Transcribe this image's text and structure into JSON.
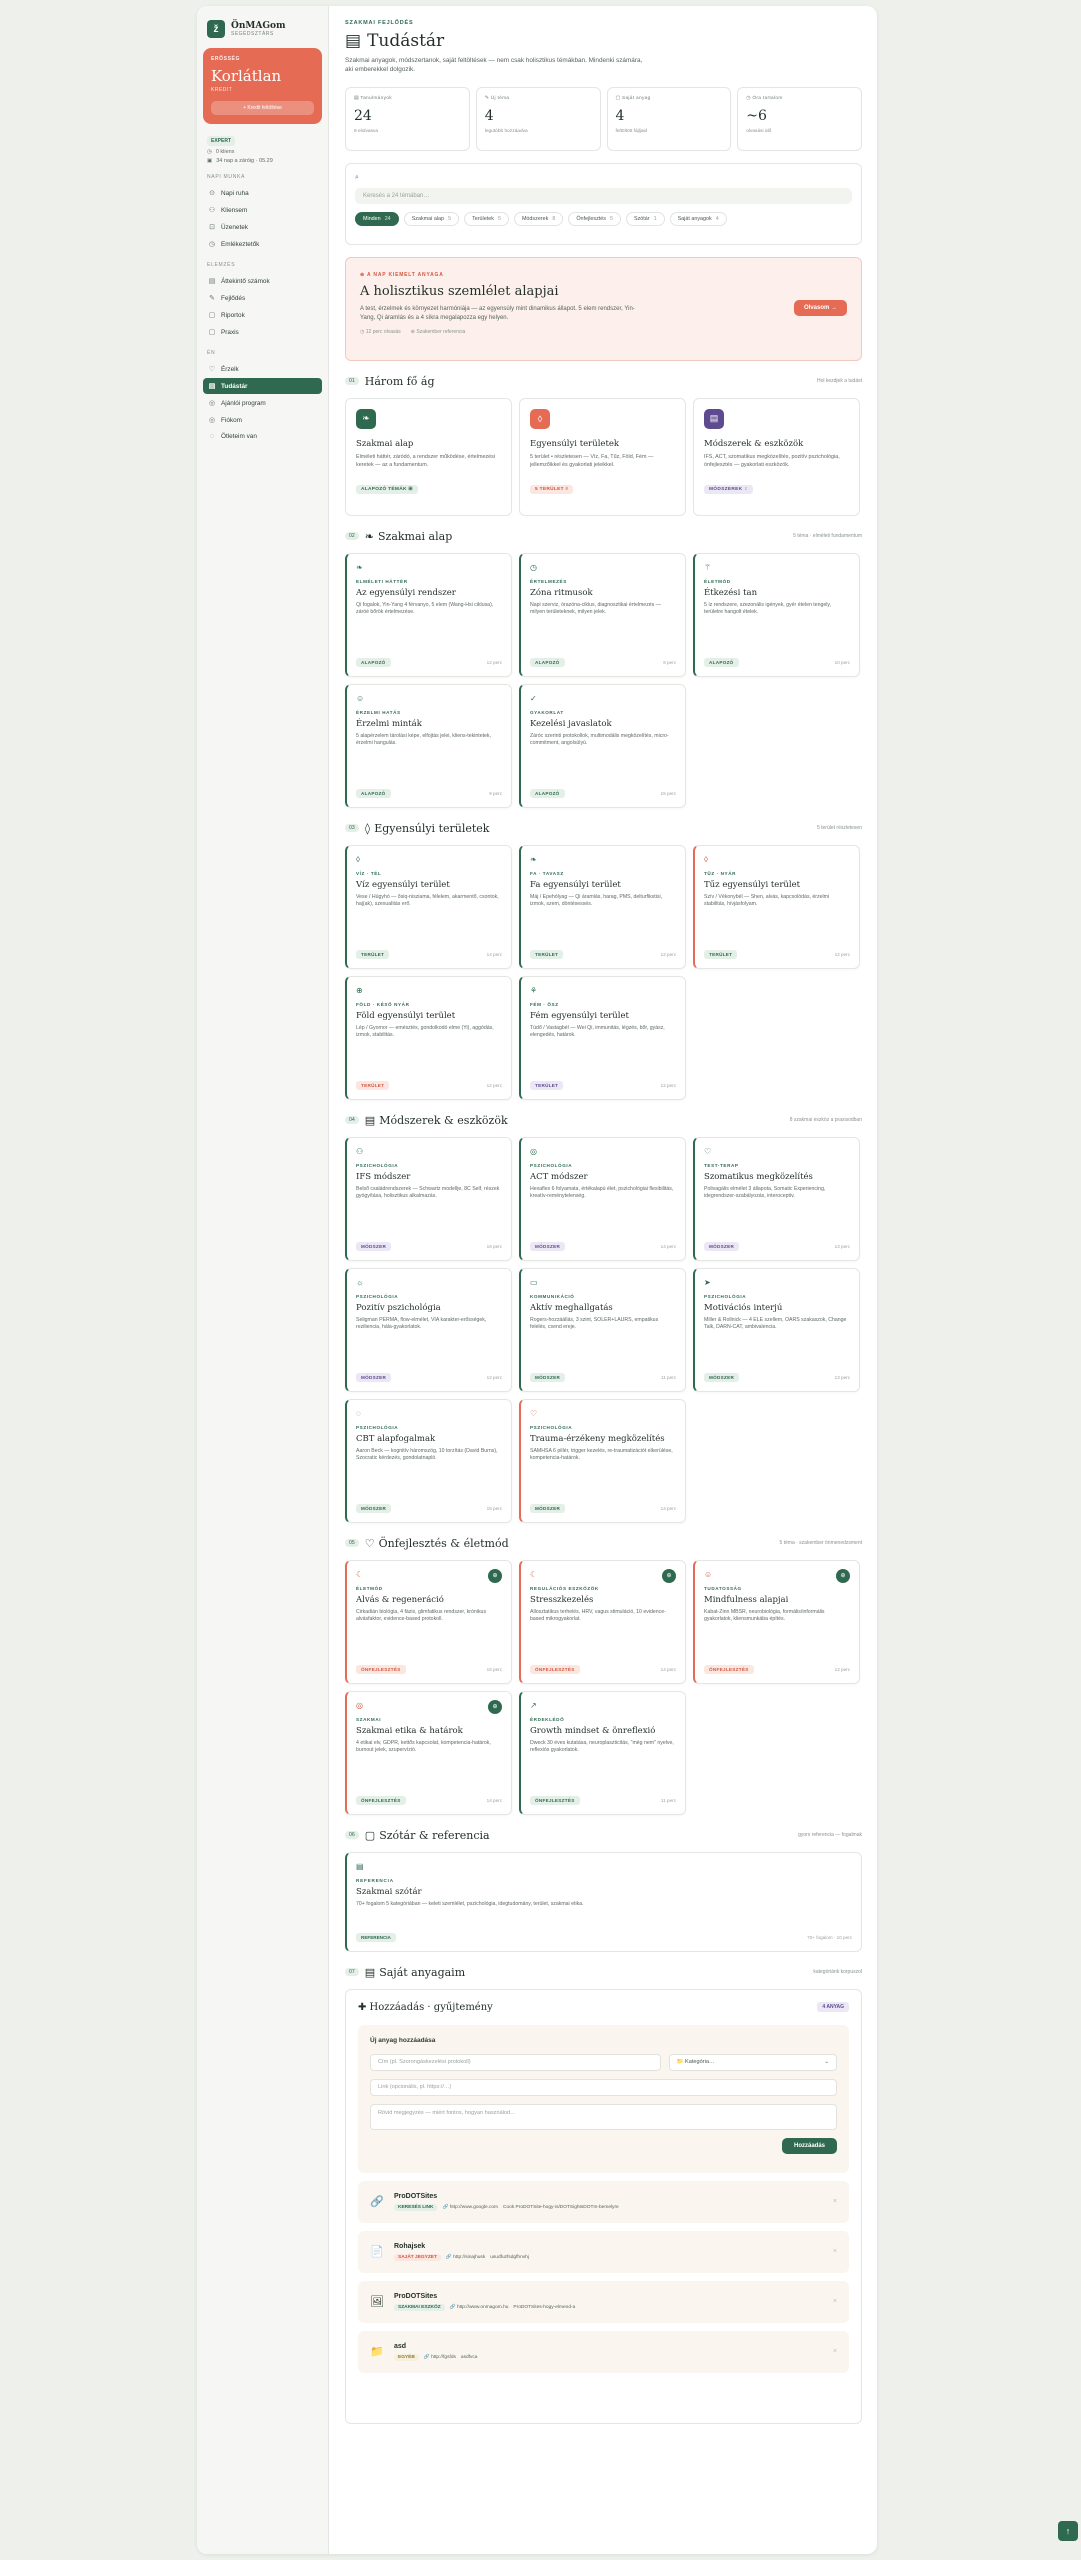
{
  "brand": {
    "logo": "ž",
    "title": "ÖnMAGom",
    "subtitle": "SEGÉDSZTÁRS"
  },
  "user": {
    "label": "ERŐSSÉG",
    "name": "Korlátlan",
    "sub": "KREDIT",
    "button": "+ Kredit feltöltése"
  },
  "sidebar": {
    "role_badge": "EXPERT",
    "meta": [
      {
        "icon": "◷",
        "text": "0 klienx"
      },
      {
        "icon": "▣",
        "text": "34 nap a záróig · 05.29"
      }
    ],
    "sections": [
      {
        "title": "NAPI MUNKA",
        "items": [
          {
            "icon": "⊙",
            "label": "Napi ruha"
          },
          {
            "icon": "⚇",
            "label": "Kliensem"
          },
          {
            "icon": "⊡",
            "label": "Üzenetek"
          },
          {
            "icon": "◷",
            "label": "Emlékeztetők"
          }
        ]
      },
      {
        "title": "ELEMZÉS",
        "items": [
          {
            "icon": "▤",
            "label": "Áttekintő számok"
          },
          {
            "icon": "✎",
            "label": "Fejlődés"
          },
          {
            "icon": "▢",
            "label": "Riportok"
          },
          {
            "icon": "▢",
            "label": "Praxis"
          }
        ]
      },
      {
        "title": "ÉN",
        "items": [
          {
            "icon": "♡",
            "label": "Érzelk"
          },
          {
            "icon": "▤",
            "label": "Tudástár",
            "active": true
          },
          {
            "icon": "◎",
            "label": "Ajánlói program"
          },
          {
            "icon": "◎",
            "label": "Fiókom"
          },
          {
            "icon": "◌",
            "label": "Ötleteim van"
          }
        ]
      }
    ]
  },
  "page": {
    "kicker": "SZAKMAI FEJLŐDÉS",
    "title": "Tudástár",
    "desc": "Szakmai anyagok, módszertanok, saját feltöltések — nem csak holisztikus témákban. Mindenki számára, aki emberekkel dolgozik."
  },
  "stats": [
    {
      "label": "▤ Tanulmányok",
      "value": "24",
      "sub": "9 elolvasva"
    },
    {
      "label": "✎ Új téma",
      "value": "4",
      "sub": "legutóbb hozzáadva"
    },
    {
      "label": "▢ Saját anyag",
      "value": "4",
      "sub": "feltöltött fájljaid"
    },
    {
      "label": "◷ Óra tartalom",
      "value": "~6",
      "sub": "olvasási idő"
    }
  ],
  "search": {
    "placeholder": "Keresés a 24 témában…",
    "chips": [
      {
        "label": "Minden",
        "count": "24",
        "on": true
      },
      {
        "label": "Szakmai alap",
        "count": "5"
      },
      {
        "label": "Területek",
        "count": "5"
      },
      {
        "label": "Módszerek",
        "count": "8"
      },
      {
        "label": "Önfejlesztés",
        "count": "5"
      },
      {
        "label": "Szótár",
        "count": "1"
      },
      {
        "label": "Saját anyagok",
        "count": "4"
      }
    ]
  },
  "hero": {
    "kicker": "⊕ A NAP KIEMELT ANYAGA",
    "title": "A holisztikus szemlélet alapjai",
    "desc": "A test, érzelmek és környezet harmóniája — az egyensúly mint dinamikus állapot. 5 elem rendszer, Yin-Yang, Qi áramlás és a 4 síkra megalapozza egy helyen.",
    "meta": [
      "◷ 12 perc olvasás",
      "⊕ Szakember referencia"
    ],
    "button": "Olvasom →"
  },
  "sections": {
    "s1": {
      "num": "01",
      "title": "Három fő ág",
      "note": "Hol kezdjek a tudást"
    },
    "s2": {
      "num": "02",
      "icon": "❧",
      "title": "Szakmai alap",
      "note": "5 téma · elméleti fundamentum"
    },
    "s3": {
      "num": "03",
      "icon": "◊",
      "title": "Egyensúlyi területek",
      "note": "5 terület részletesen"
    },
    "s4": {
      "num": "04",
      "icon": "▤",
      "title": "Módszerek & eszközök",
      "note": "8 szakmai eszköz a praxisodban"
    },
    "s5": {
      "num": "05",
      "icon": "♡",
      "title": "Önfejlesztés & életmód",
      "note": "5 téma · szakember önmenedzsment"
    },
    "s6": {
      "num": "06",
      "icon": "▢",
      "title": "Szótár & referencia",
      "note": "gyors referencia — fogalmak"
    },
    "s7": {
      "num": "07",
      "icon": "▤",
      "title": "Saját anyagaim",
      "note": "kategóriánk korpuszol"
    }
  },
  "pillars": [
    {
      "icon": "❧",
      "color": "#2f6a50",
      "title": "Szakmai alap",
      "desc": "Elméleti háttér, záródó, a rendszer működése, értelmezési keretek — az a fundamentum.",
      "tag": "ALAPOZÓ TÉMÁK ⊞",
      "tagc": "tg-g"
    },
    {
      "icon": "◊",
      "color": "#e56b55",
      "title": "Egyensúlyi területek",
      "desc": "5 terület • részletesen — Víz, Fa, Tűz, Föld, Fém — jellemzőikkel és gyakorlati jeleikkel.",
      "tag": "5 TERÜLET ◊",
      "tagc": "tg-r"
    },
    {
      "icon": "▤",
      "color": "#5e4a8f",
      "title": "Módszerek & eszközök",
      "desc": "IFS, ACT, szomatikus megközelítés, pozitív pszichológia, önfejlesztés — gyakorlati eszközök.",
      "tag": "MÓDSZEREK ♀",
      "tagc": "tg-p"
    }
  ],
  "alap": [
    {
      "icon": "❧",
      "k": "ELMÉLETI HÁTTÉR",
      "t": "Az egyensúlyi rendszer",
      "d": "Qi fogalok, Yin-Yang 4 férvanyo, 5 elem (Wang-Hsi ciklusa), záróé bőrök értelmezése.",
      "tag": "ALAPOZÓ",
      "tc": "tg-g",
      "time": "12 perc"
    },
    {
      "icon": "◷",
      "k": "ÉRTELMEZÉS",
      "t": "Zóna ritmusok",
      "d": "Napi szerviz, órazóna-ciklus, diagnosztikai értelmezés — milyen területeknek, milyen jelek.",
      "tag": "ALAPOZÓ",
      "tc": "tg-g",
      "time": "8 perc"
    },
    {
      "icon": "⚚",
      "k": "ÉLETMÓD",
      "t": "Étkezési tan",
      "d": "5 íz rendszere, szezonális igények, gyér ételen tengely, területre hangolt ételek.",
      "tag": "ALAPOZÓ",
      "tc": "tg-g",
      "time": "10 perc"
    },
    {
      "icon": "☺",
      "k": "ÉRZELMI HATÁS",
      "t": "Érzelmi minták",
      "d": "5 alapérzelem tárolási képe, elfojtás jelei, kliens-tekintetek, érzelmi hangulás.",
      "tag": "ALAPOZÓ",
      "tc": "tg-g",
      "time": "9 perc"
    },
    {
      "icon": "✓",
      "k": "GYAKORLAT",
      "t": "Kezelési javaslatok",
      "d": "Záróc szerinti protokollok, multimodális megközelítés, micro-commitment, angolsúlyú.",
      "tag": "ALAPOZÓ",
      "tc": "tg-g",
      "time": "15 perc"
    }
  ],
  "areas": [
    {
      "icon": "◊",
      "k": "VÍZ · TÉL",
      "t": "Víz egyensúlyi terület",
      "d": "Vese / Húgyhó — ősiq-nisziama, félelem, akarmentő, csontok, haj(ak), szexualitás erő.",
      "tag": "TERÜLET",
      "tc": "tg-g",
      "time": "14 perc",
      "red": false
    },
    {
      "icon": "❧",
      "k": "FA · TAVASZ",
      "t": "Fa egyensúlyi terület",
      "d": "Máj / Epehólyag — Qi áramlás, harag, PMS, delturfikstisi, izmok, szem, döntésessés.",
      "tag": "TERÜLET",
      "tc": "tg-g",
      "time": "12 perc",
      "red": false
    },
    {
      "icon": "◊",
      "k": "TŰZ · NYÁR",
      "t": "Tűz egyensúlyi terület",
      "d": "Szív / Vékonybél — Shen, alvás, kapcsolódás, érzelmi stabilitás, hívjásfolyam.",
      "tag": "TERÜLET",
      "tc": "tg-g",
      "time": "12 perc",
      "red": true
    },
    {
      "icon": "⊕",
      "k": "FÖLD · KÉSŐ NYÁR",
      "t": "Föld egyensúlyi terület",
      "d": "Lép / Gyomor — emésztés, gondolkodó elme (Yi), aggódás, izmok, stabilitás.",
      "tag": "TERÜLET",
      "tc": "tg-r",
      "time": "12 perc",
      "red": false
    },
    {
      "icon": "⚘",
      "k": "FÉM · ŐSZ",
      "t": "Fém egyensúlyi terület",
      "d": "Tüdő / Vastagbél — Wei Qi, immunitás, légzés, bőr, gyász, elengedés, határok.",
      "tag": "TERÜLET",
      "tc": "tg-p",
      "time": "12 perc",
      "red": false
    }
  ],
  "methods": [
    {
      "icon": "⚇",
      "k": "PSZICHOLÓGIA",
      "t": "IFS módszer",
      "d": "Belső családrendszerek — Schwartz modellje, 8C Self, részek gyógyítása, holisztikus alkalmazás.",
      "tag": "MÓDSZER",
      "tc": "tg-p",
      "time": "16 perc",
      "red": false
    },
    {
      "icon": "◎",
      "k": "PSZICHOLÓGIA",
      "t": "ACT módszer",
      "d": "Hexaflex 6 folyamata, értékalapú élet, pszichológiai flexibilitás, kreatív-reménytelenség.",
      "tag": "MÓDSZER",
      "tc": "tg-p",
      "time": "14 perc",
      "red": false
    },
    {
      "icon": "♡",
      "k": "TEST-TERAP",
      "t": "Szomatikus megközelítés",
      "d": "Polivagális elmélet 3 állapota, Somatic Experiencing, idegrendszer-szabályozás, interoceptiv.",
      "tag": "MÓDSZER",
      "tc": "tg-p",
      "time": "13 perc",
      "red": false
    },
    {
      "icon": "☼",
      "k": "PSZICHOLÓGIA",
      "t": "Pozitív pszichológia",
      "d": "Seligman PERMA, flow-elmélet, VIA karakter-erősségek, reziliencia, hála-gyakorlatok.",
      "tag": "MÓDSZER",
      "tc": "tg-p",
      "time": "12 perc",
      "red": false
    },
    {
      "icon": "▭",
      "k": "KOMMUNIKÁCIÓ",
      "t": "Aktív meghallgatás",
      "d": "Rogers-hozzáállás, 3 szint, SOLER+LAURS, empatikus felelés, csend ereje.",
      "tag": "MÓDSZER",
      "tc": "tg-g",
      "time": "11 perc",
      "red": false
    },
    {
      "icon": "➤",
      "k": "PSZICHOLÓGIA",
      "t": "Motivációs interjú",
      "d": "Miller & Rollnick — 4 ELE szellem, OARS szakaszok, Change Talk, DARN-CAT, ambivalencia.",
      "tag": "MÓDSZER",
      "tc": "tg-g",
      "time": "13 perc",
      "red": false
    },
    {
      "icon": "◌",
      "k": "PSZICHOLÓGIA",
      "t": "CBT alapfogalmak",
      "d": "Aaron Beck — kognitív háromszög, 10 torzítás (David Burns), Szocratic kérdezés, gondolatnapló.",
      "tag": "MÓDSZER",
      "tc": "tg-g",
      "time": "15 perc",
      "red": false
    },
    {
      "icon": "♡",
      "k": "PSZICHOLÓGIA",
      "t": "Trauma-érzékeny megközelítés",
      "d": "SAMHSA 6 pillér, trigger kezelés, re-traumatizációt elkerülése, kompetencia-határok.",
      "tag": "MÓDSZER",
      "tc": "tg-g",
      "time": "14 perc",
      "red": true
    }
  ],
  "self": [
    {
      "icon": "☾",
      "k": "ÉLETMÓD",
      "t": "Alvás & regeneráció",
      "d": "Cirkadián biológia, 4 fázis, glimfatikus rendszer, krónikus alvásfaktor, evidence-based protokoll.",
      "tag": "ÖNFEJLESZTÉS",
      "tc": "tg-r",
      "time": "15 perc",
      "stamp": "⊕",
      "red": true
    },
    {
      "icon": "☾",
      "k": "REGULÁCIÓS ESZKÖZÖK",
      "t": "Stresszkezelés",
      "d": "Allosztatikus terhelés, HRV, vagus stimuláció, 10 evidence-based mikrogyakorlat.",
      "tag": "ÖNFEJLESZTÉS",
      "tc": "tg-r",
      "time": "14 perc",
      "stamp": "⊕",
      "red": true
    },
    {
      "icon": "☺",
      "k": "TUDATOSSÁG",
      "t": "Mindfulness alapjai",
      "d": "Kabat-Zinn MBSR, neurobiológia, formális/informális gyakorlatok, kliensmunkába építés.",
      "tag": "ÖNFEJLESZTÉS",
      "tc": "tg-r",
      "time": "12 perc",
      "stamp": "⊕",
      "red": true
    },
    {
      "icon": "◎",
      "k": "SZAKMAI",
      "t": "Szakmai etika & határok",
      "d": "4 etikai elv, GDPR, kettős kapcsolat, kompetencia-határok, burnout jelek, szupervízió.",
      "tag": "ÖNFEJLESZTÉS",
      "tc": "tg-g",
      "time": "14 perc",
      "stamp": "⊕",
      "red": true
    },
    {
      "icon": "↗",
      "k": "ÉRDEKLÉDŐ",
      "t": "Growth mindset & önreflexió",
      "d": "Dweck 30 éves kutatása, neuroplaszticitás, \"még nem\" nyelve, reflexiós gyakorlatok.",
      "tag": "ÖNFEJLESZTÉS",
      "tc": "tg-g",
      "time": "11 perc",
      "stamp": "",
      "red": false
    }
  ],
  "dict": {
    "icon": "▤",
    "k": "REFERENCIA",
    "t": "Szakmai szótár",
    "d": "70+ fogalom 5 kategóriában — keleti szemlélet, pszichológia, idegtudomány, terület, szakmai etika.",
    "tag": "REFERENCIA",
    "time": "70+ fogalom · 10 perc"
  },
  "add": {
    "title": "✚ Hozzáadás · gyűjtemény",
    "badge": "4 ANYAG",
    "form_title": "Új anyag hozzáadása",
    "title_ph": "Cím (pl. Szorongáskezelési protokoll)",
    "cat_value": "📁 Kategória…",
    "link_ph": "Link (opcionális, pl. https://…)",
    "note_ph": "Rövid megjegyzés — miért fontos, hogyan használod…",
    "save": "Hozzáadás"
  },
  "materials": [
    {
      "icon": "🔗",
      "title": "ProDOTSites",
      "tag": "KERESÉS LINK",
      "tc": "tg-g",
      "link": "🔗 http://www.google.com",
      "extra": "Cook ProDOTSite-hogy-is/DOTSightsDOTIn-bemelyre"
    },
    {
      "icon": "📄",
      "title": "Rohajsek",
      "tag": "SAJÁT JEGYZET",
      "tc": "tg-r",
      "link": "🔗 http://sinajhusk",
      "extra": "usudfuzfsdgfhnvhj"
    },
    {
      "icon": "🖼",
      "title": "ProDOTSites",
      "tag": "SZAKMAI ESZKÖZ",
      "tc": "tg-g",
      "link": "🔗 http://www.onmagom.hu",
      "extra": "ProDOTSites-hogy-elmend-a"
    },
    {
      "icon": "📁",
      "title": "asd",
      "tag": "EGYÉB",
      "tc": "tg-y",
      "link": "🔗 http://fgsfds",
      "extra": "asdfvca"
    }
  ],
  "fab": "↑"
}
